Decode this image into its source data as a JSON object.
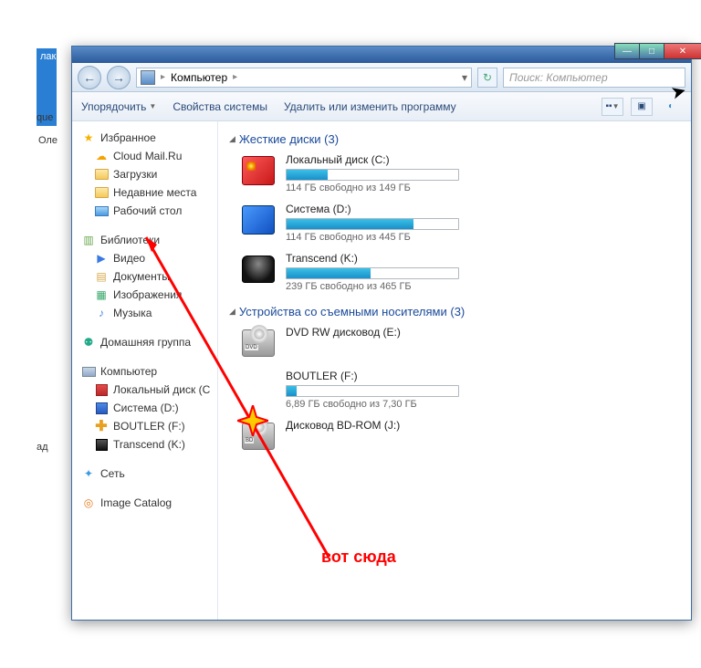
{
  "background": {
    "text1": "лако",
    "text2": "que",
    "text3": "Оле",
    "text4": "ад"
  },
  "titlebar": {
    "min": "—",
    "max": "□",
    "close": "✕"
  },
  "nav": {
    "back": "←",
    "forward": "→",
    "breadcrumb_root": "Компьютер",
    "refresh": "↻"
  },
  "search": {
    "placeholder": "Поиск: Компьютер"
  },
  "toolbar": {
    "organize": "Упорядочить",
    "properties": "Свойства системы",
    "uninstall": "Удалить или изменить программу"
  },
  "sidebar": {
    "favorites": {
      "head": "Избранное",
      "items": [
        "Cloud Mail.Ru",
        "Загрузки",
        "Недавние места",
        "Рабочий стол"
      ]
    },
    "libraries": {
      "head": "Библиотеки",
      "items": [
        "Видео",
        "Документы",
        "Изображения",
        "Музыка"
      ]
    },
    "homegroup": "Домашняя группа",
    "computer": {
      "head": "Компьютер",
      "items": [
        "Локальный диск (C",
        "Система (D:)",
        "BOUTLER (F:)",
        "Transcend (K:)"
      ]
    },
    "network": "Сеть",
    "catalog": "Image Catalog"
  },
  "main": {
    "hdd_group": "Жесткие диски (3)",
    "hdd": [
      {
        "name": "Локальный диск (C:)",
        "text": "114 ГБ свободно из 149 ГБ",
        "fill": 24
      },
      {
        "name": "Система (D:)",
        "text": "114 ГБ свободно из 445 ГБ",
        "fill": 74
      },
      {
        "name": "Transcend (K:)",
        "text": "239 ГБ свободно из 465 ГБ",
        "fill": 49
      }
    ],
    "removable_group": "Устройства со съемными носителями (3)",
    "removable": [
      {
        "name": "DVD RW дисковод (E:)",
        "label": "DVD",
        "bar": false
      },
      {
        "name": "BOUTLER (F:)",
        "text": "6,89 ГБ свободно из 7,30 ГБ",
        "fill": 6,
        "bar": true
      },
      {
        "name": "Дисковод BD-ROM (J:)",
        "label": "BD",
        "bar": false
      }
    ]
  },
  "annotation": {
    "text": "вот сюда"
  }
}
